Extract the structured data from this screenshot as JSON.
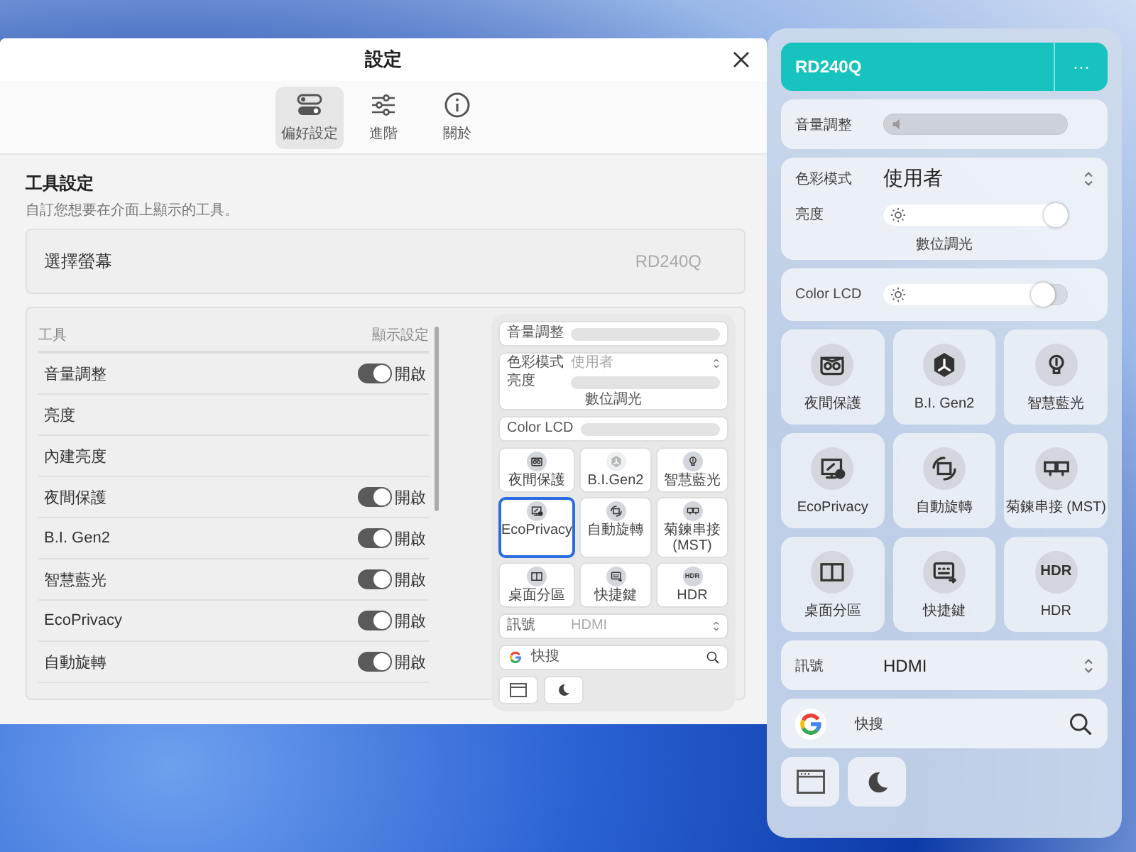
{
  "window": {
    "title": "設定"
  },
  "tabs": [
    {
      "label": "偏好設定",
      "kind": "toggles",
      "selected": true
    },
    {
      "label": "進階",
      "kind": "sliders",
      "selected": false
    },
    {
      "label": "關於",
      "kind": "info",
      "selected": false
    }
  ],
  "section": {
    "title": "工具設定",
    "subtitle": "自訂您想要在介面上顯示的工具。"
  },
  "monitor_select": {
    "label": "選擇螢幕",
    "value": "RD240Q"
  },
  "tools_table": {
    "columns": [
      "工具",
      "顯示設定"
    ],
    "rows": [
      {
        "name": "音量調整",
        "kind": "toggle",
        "on": true,
        "state_label": "開啟"
      },
      {
        "name": "亮度",
        "kind": "plain"
      },
      {
        "name": "內建亮度",
        "kind": "plain"
      },
      {
        "name": "夜間保護",
        "kind": "toggle",
        "on": true,
        "state_label": "開啟"
      },
      {
        "name": "B.I. Gen2",
        "kind": "toggle",
        "on": true,
        "state_label": "開啟"
      },
      {
        "name": "智慧藍光",
        "kind": "toggle",
        "on": true,
        "state_label": "開啟"
      },
      {
        "name": "EcoPrivacy",
        "kind": "toggle",
        "on": true,
        "state_label": "開啟"
      },
      {
        "name": "自動旋轉",
        "kind": "toggle",
        "on": true,
        "state_label": "開啟"
      }
    ]
  },
  "preview": {
    "volume": {
      "label": "音量調整"
    },
    "color_mode": {
      "label": "色彩模式",
      "value": "使用者"
    },
    "brightness": {
      "label": "亮度",
      "caption": "數位調光"
    },
    "color_lcd": {
      "label": "Color LCD"
    },
    "tiles": [
      {
        "label": "夜間保護",
        "kind": "night",
        "selected": false,
        "disabled": false
      },
      {
        "label": "B.I.Gen2",
        "kind": "bi",
        "selected": false,
        "disabled": true
      },
      {
        "label": "智慧藍光",
        "kind": "bulb",
        "selected": false,
        "disabled": false
      },
      {
        "label": "EcoPrivacy",
        "kind": "eco",
        "selected": true,
        "disabled": false
      },
      {
        "label": "自動旋轉",
        "kind": "rotate",
        "selected": false,
        "disabled": false
      },
      {
        "label": "菊鍊串接 (MST)",
        "kind": "dual",
        "selected": false,
        "disabled": false
      },
      {
        "label": "桌面分區",
        "kind": "split",
        "selected": false,
        "disabled": false
      },
      {
        "label": "快捷鍵",
        "kind": "keys",
        "selected": false,
        "disabled": false
      },
      {
        "label": "HDR",
        "kind": "text",
        "selected": false,
        "disabled": false
      }
    ],
    "tile_logo_text": "HDR",
    "signal": {
      "label": "訊號",
      "value": "HDMI"
    },
    "search": {
      "label": "快搜"
    }
  },
  "panel": {
    "device": "RD240Q",
    "more": "···",
    "volume": {
      "label": "音量調整",
      "disabled": true
    },
    "color_mode": {
      "label": "色彩模式",
      "value": "使用者"
    },
    "brightness": {
      "label": "亮度",
      "level": 1,
      "caption": "數位調光"
    },
    "color_lcd": {
      "label": "Color LCD",
      "level": 0.93
    },
    "tiles": [
      {
        "label": "夜間保護",
        "kind": "night"
      },
      {
        "label": "B.I. Gen2",
        "kind": "bi"
      },
      {
        "label": "智慧藍光",
        "kind": "bulb"
      },
      {
        "label": "EcoPrivacy",
        "kind": "eco"
      },
      {
        "label": "自動旋轉",
        "kind": "rotate"
      },
      {
        "label": "菊鍊串接 (MST)",
        "kind": "dual"
      },
      {
        "label": "桌面分區",
        "kind": "split"
      },
      {
        "label": "快捷鍵",
        "kind": "keys"
      },
      {
        "label": "HDR",
        "kind": "text"
      }
    ],
    "tile_logo_text": "HDR",
    "signal": {
      "label": "訊號",
      "value": "HDMI"
    },
    "search": {
      "label": "快搜"
    }
  }
}
